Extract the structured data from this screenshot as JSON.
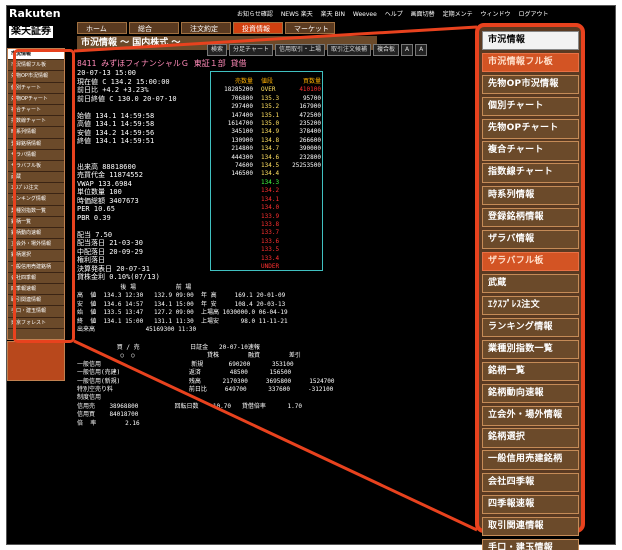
{
  "app": {
    "brand_top": "Rakuten",
    "brand_bottom": "楽天証券",
    "top_links": [
      "お知らせ確認",
      "NEWS 楽天",
      "楽天 BIN",
      "Weevee",
      "ヘルプ",
      "画面切替",
      "定期メンテ",
      "ウィンドウ",
      "ログアウト"
    ],
    "tabs": [
      "ホーム",
      "総合",
      "注文約定",
      "投資情報",
      "マーケット"
    ],
    "active_tab_index": 3,
    "page_title": "市況情報 ～ 国内株式 ～",
    "toolbar": [
      "検索",
      "分足チャート",
      "信用取引・上場",
      "取引注文候補",
      "複合板",
      "A",
      "A"
    ]
  },
  "mini_sidebar": {
    "items": [
      "市況情報",
      "市況情報フル板",
      "先物OP市況情報",
      "個別チャート",
      "先物OPチャート",
      "複合チャート",
      "指数線チャート",
      "時系列情報",
      "登録銘柄情報",
      "ザラバ情報",
      "ザラバフル板",
      "武蔵",
      "ｴｸｽﾌﾟﾚｽ注文",
      "ランキング情報",
      "業種別指数一覧",
      "銘柄一覧",
      "銘柄動向速報",
      "立会外・場外情報",
      "銘柄選択",
      "一般信用売建銘柄",
      "会社四季報",
      "四季報速報",
      "取引関連情報",
      "手口・建玉情報",
      "東京フォレスト"
    ]
  },
  "quote": {
    "title": "8411  みずほフィナンシャルＧ  東証１部  貸借",
    "rows": [
      "20-07-13 15:00",
      "現在値  C  134.2 15:00:00",
      "前日比     +4.2 +3.23%",
      "前日終値 C 130.0 20-07-10",
      "",
      "始値     134.1 14:59:58",
      "高値     134.1 14:59:58",
      "安値     134.2 14:59:56",
      "終値     134.1 14:59:51",
      "",
      "",
      "出来高   88818600",
      "売買代金  11874552",
      "VWAP    133.6984",
      "単位数量       100",
      "時価総額  3407673",
      "PER       10.65",
      "PBR        0.39",
      "",
      "配当      7.50",
      "配当落日  21-03-30",
      "中配落日  20-09-29",
      "権利落日",
      "決算発表日 20-07-31",
      "貸株金利   0.10%(07/13)"
    ]
  },
  "order_book": {
    "headers": [
      "売数量",
      "値段",
      "買数量"
    ],
    "rows": [
      {
        "sell": "",
        "price": "OVER",
        "buy": ""
      },
      {
        "sell": "18285200",
        "price": "135.3",
        "buy": ""
      },
      {
        "sell": "706800",
        "price": "135.2",
        "buy": ""
      },
      {
        "sell": "297400",
        "price": "135.1",
        "buy": ""
      },
      {
        "sell": "147400",
        "price": "135.0",
        "buy": ""
      },
      {
        "sell": "1614700",
        "price": "134.9",
        "buy": ""
      },
      {
        "sell": "345100",
        "price": "134.8",
        "buy": ""
      },
      {
        "sell": "130900",
        "price": "134.7",
        "buy": ""
      },
      {
        "sell": "214800",
        "price": "134.6",
        "buy": ""
      },
      {
        "sell": "444300",
        "price": "134.5",
        "buy": ""
      },
      {
        "sell": "74600",
        "price": "134.4",
        "buy": ""
      },
      {
        "sell": "146500",
        "price": "134.3",
        "buy": ""
      },
      {
        "sell": "",
        "price": "134.2",
        "buy": "410100"
      },
      {
        "sell": "",
        "price": "134.1",
        "buy": "95700"
      },
      {
        "sell": "",
        "price": "134.0",
        "buy": "167900"
      },
      {
        "sell": "",
        "price": "133.9",
        "buy": "472500"
      },
      {
        "sell": "",
        "price": "133.8",
        "buy": "235200"
      },
      {
        "sell": "",
        "price": "133.7",
        "buy": "378400"
      },
      {
        "sell": "",
        "price": "133.6",
        "buy": "266600"
      },
      {
        "sell": "",
        "price": "133.5",
        "buy": "390000"
      },
      {
        "sell": "",
        "price": "133.4",
        "buy": "232800"
      },
      {
        "sell": "",
        "price": "UNDER",
        "buy": "25253500"
      }
    ]
  },
  "session": {
    "text": "            後 場           前 場\n高  値  134.3 12:30   132.9 09:00  年 高     169.1 20-01-09\n安  値  134.6 14:57   134.1 15:00  年 安     108.4 20-03-13\n始  値  133.5 13:47   127.2 09:00  上場高 1030000.0 06-04-19\n終  値  134.1 15:00   131.1 11:30  上場安      98.0 11-11-21\n出来高              45169300 11:30"
  },
  "credit": {
    "text": "           買 / 売              日証金   20-07-10速報\n            ○  ○                    貸株        融資        差引\n一般信用                         新規       690200      353100\n一般信用(売建)                   返済        48500      156500\n一般信用(新規)                   残高      2170300     3695800     1524700\n特別空売り料                     前日比     649700      337600     -312100\n制度信用\n信用売    38968800          回転日数    10.70   貸借倍率      1.70\n信用買    84018700\n倍  率        2.16"
  },
  "zoom_sidebar": {
    "items": [
      "市況情報",
      "市況情報フル板",
      "先物OP市況情報",
      "個別チャート",
      "先物OPチャート",
      "複合チャート",
      "指数線チャート",
      "時系列情報",
      "登録銘柄情報",
      "ザラバ情報",
      "ザラバフル板",
      "武蔵",
      "ｴｸｽﾌﾟﾚｽ注文",
      "ランキング情報",
      "業種別指数一覧",
      "銘柄一覧",
      "銘柄動向速報",
      "立会外・場外情報",
      "銘柄選択",
      "一般信用売建銘柄",
      "会社四季報",
      "四季報速報",
      "取引関連情報",
      "手口・建玉情報"
    ],
    "header_index": 0,
    "highlighted_indices": [
      1,
      10
    ]
  },
  "colors": {
    "callout_border": "#e8421e",
    "menu_bg": "#6b4a2a",
    "menu_highlight": "#d35424"
  }
}
